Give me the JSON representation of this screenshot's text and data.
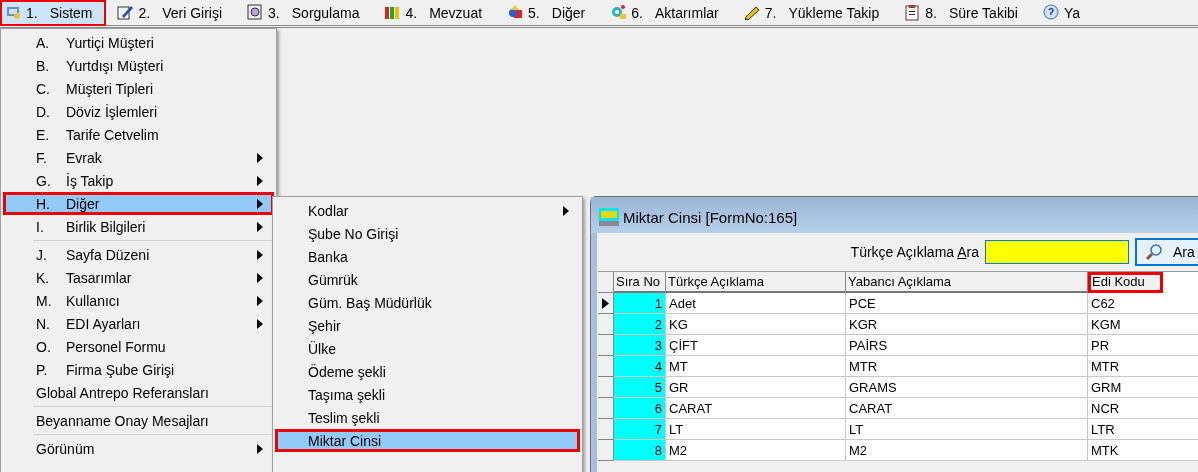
{
  "menubar": [
    {
      "number": "1.",
      "label": "Sistem",
      "selected": true,
      "annotated": true
    },
    {
      "number": "2.",
      "label": "Veri Girişi",
      "selected": false,
      "annotated": false
    },
    {
      "number": "3.",
      "label": "Sorgulama",
      "selected": false,
      "annotated": false
    },
    {
      "number": "4.",
      "label": "Mevzuat",
      "selected": false,
      "annotated": false
    },
    {
      "number": "5.",
      "label": "Diğer",
      "selected": false,
      "annotated": false
    },
    {
      "number": "6.",
      "label": "Aktarımlar",
      "selected": false,
      "annotated": false
    },
    {
      "number": "7.",
      "label": "Yükleme Takip",
      "selected": false,
      "annotated": false
    },
    {
      "number": "8.",
      "label": "Süre Takibi",
      "selected": false,
      "annotated": false
    },
    {
      "label": "Ya",
      "selected": false,
      "annotated": false
    }
  ],
  "main_menu": [
    {
      "kind": "item",
      "key": "A.",
      "label": "Yurtiçi Müşteri",
      "has_submenu": false,
      "selected": false,
      "annotated": false
    },
    {
      "kind": "item",
      "key": "B.",
      "label": "Yurtdışı Müşteri",
      "has_submenu": false,
      "selected": false,
      "annotated": false
    },
    {
      "kind": "item",
      "key": "C.",
      "label": "Müşteri Tipleri",
      "has_submenu": false,
      "selected": false,
      "annotated": false
    },
    {
      "kind": "item",
      "key": "D.",
      "label": "Döviz İşlemleri",
      "has_submenu": false,
      "selected": false,
      "annotated": false
    },
    {
      "kind": "item",
      "key": "E.",
      "label": "Tarife Cetvelim",
      "has_submenu": false,
      "selected": false,
      "annotated": false
    },
    {
      "kind": "item",
      "key": "F.",
      "label": "Evrak",
      "has_submenu": true,
      "selected": false,
      "annotated": false
    },
    {
      "kind": "item",
      "key": "G.",
      "label": "İş Takip",
      "has_submenu": true,
      "selected": false,
      "annotated": false
    },
    {
      "kind": "item",
      "key": "H.",
      "label": "Diğer",
      "has_submenu": true,
      "selected": true,
      "annotated": true
    },
    {
      "kind": "item",
      "key": "I.",
      "label": "Birlik Bilgileri",
      "has_submenu": true,
      "selected": false,
      "annotated": false
    },
    {
      "kind": "separator"
    },
    {
      "kind": "item",
      "key": "J.",
      "label": "Sayfa Düzeni",
      "has_submenu": true,
      "selected": false,
      "annotated": false
    },
    {
      "kind": "item",
      "key": "K.",
      "label": "Tasarımlar",
      "has_submenu": true,
      "selected": false,
      "annotated": false
    },
    {
      "kind": "item",
      "key": "M.",
      "label": "Kullanıcı",
      "has_submenu": true,
      "selected": false,
      "annotated": false
    },
    {
      "kind": "item",
      "key": "N.",
      "label": "EDI Ayarları",
      "has_submenu": true,
      "selected": false,
      "annotated": false
    },
    {
      "kind": "item",
      "key": "O.",
      "label": "Personel Formu",
      "has_submenu": false,
      "selected": false,
      "annotated": false
    },
    {
      "kind": "item",
      "key": "P.",
      "label": "Firma Şube Girişi",
      "has_submenu": false,
      "selected": false,
      "annotated": false
    },
    {
      "kind": "item",
      "label": "Global Antrepo Referansları",
      "has_submenu": false,
      "selected": false,
      "annotated": false
    },
    {
      "kind": "separator"
    },
    {
      "kind": "item",
      "label": "Beyanname Onay Mesajları",
      "has_submenu": false,
      "selected": false,
      "annotated": false
    },
    {
      "kind": "separator"
    },
    {
      "kind": "item",
      "label": "Görünüm",
      "has_submenu": true,
      "selected": false,
      "annotated": false
    }
  ],
  "sub_menu": [
    {
      "label": "Kodlar",
      "has_submenu": true,
      "selected": false,
      "annotated": false
    },
    {
      "label": "Şube No Girişi",
      "has_submenu": false,
      "selected": false,
      "annotated": false
    },
    {
      "label": "Banka",
      "has_submenu": false,
      "selected": false,
      "annotated": false
    },
    {
      "label": "Gümrük",
      "has_submenu": false,
      "selected": false,
      "annotated": false
    },
    {
      "label": "Güm. Baş Müdürlük",
      "has_submenu": false,
      "selected": false,
      "annotated": false
    },
    {
      "label": "Şehir",
      "has_submenu": false,
      "selected": false,
      "annotated": false
    },
    {
      "label": "Ülke",
      "has_submenu": false,
      "selected": false,
      "annotated": false
    },
    {
      "label": "Ödeme şekli",
      "has_submenu": false,
      "selected": false,
      "annotated": false
    },
    {
      "label": "Taşıma şekli",
      "has_submenu": false,
      "selected": false,
      "annotated": false
    },
    {
      "label": "Teslim şekli",
      "has_submenu": false,
      "selected": false,
      "annotated": false
    },
    {
      "label": "Miktar Cinsi",
      "has_submenu": false,
      "selected": true,
      "annotated": true
    }
  ],
  "form": {
    "title": "Miktar Cinsi [FormNo:165]",
    "search": {
      "label_before": "Türkçe Açıklama ",
      "label_access": "A",
      "label_after": "ra",
      "button": "Ara"
    },
    "table": {
      "columns": [
        {
          "label": "Sıra No",
          "annotated": false
        },
        {
          "label": "Türkçe Açıklama",
          "annotated": false
        },
        {
          "label": "Yabancı Açıklama",
          "annotated": false
        },
        {
          "label": "Edi Kodu",
          "annotated": true
        }
      ],
      "rows": [
        {
          "current": true,
          "cells": [
            "1",
            "Adet",
            "PCE",
            "C62"
          ]
        },
        {
          "current": false,
          "cells": [
            "2",
            "KG",
            "KGR",
            "KGM"
          ]
        },
        {
          "current": false,
          "cells": [
            "3",
            "ÇİFT",
            "PAİRS",
            "PR"
          ]
        },
        {
          "current": false,
          "cells": [
            "4",
            "MT",
            "MTR",
            "MTR"
          ]
        },
        {
          "current": false,
          "cells": [
            "5",
            "GR",
            "GRAMS",
            "GRM"
          ]
        },
        {
          "current": false,
          "cells": [
            "6",
            "CARAT",
            "CARAT",
            "NCR"
          ]
        },
        {
          "current": false,
          "cells": [
            "7",
            "LT",
            "LT",
            "LTR"
          ]
        },
        {
          "current": false,
          "cells": [
            "8",
            "M2",
            "M2",
            "MTK"
          ]
        }
      ]
    }
  }
}
